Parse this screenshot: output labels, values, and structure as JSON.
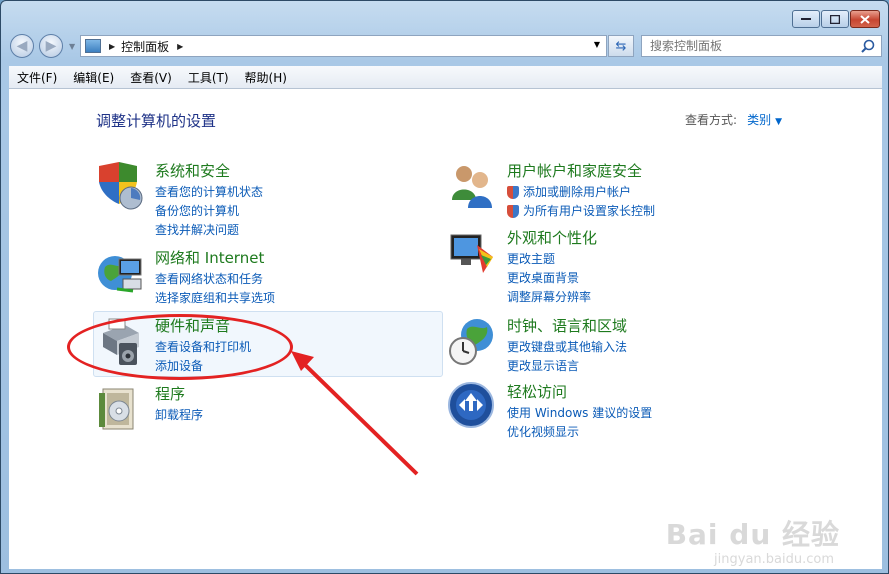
{
  "address": {
    "crumb": "控制面板"
  },
  "search": {
    "placeholder": "搜索控制面板"
  },
  "menu": [
    "文件(F)",
    "编辑(E)",
    "查看(V)",
    "工具(T)",
    "帮助(H)"
  ],
  "page": {
    "title": "调整计算机的设置",
    "view_label": "查看方式:",
    "view_value": "类别"
  },
  "categories": {
    "system": {
      "title": "系统和安全",
      "links": [
        "查看您的计算机状态",
        "备份您的计算机",
        "查找并解决问题"
      ]
    },
    "network": {
      "title": "网络和 Internet",
      "links": [
        "查看网络状态和任务",
        "选择家庭组和共享选项"
      ]
    },
    "hardware": {
      "title": "硬件和声音",
      "links": [
        "查看设备和打印机",
        "添加设备"
      ]
    },
    "programs": {
      "title": "程序",
      "links": [
        "卸载程序"
      ]
    },
    "users": {
      "title": "用户帐户和家庭安全",
      "links": [
        "添加或删除用户帐户",
        "为所有用户设置家长控制"
      ]
    },
    "appearance": {
      "title": "外观和个性化",
      "links": [
        "更改主题",
        "更改桌面背景",
        "调整屏幕分辨率"
      ]
    },
    "clock": {
      "title": "时钟、语言和区域",
      "links": [
        "更改键盘或其他输入法",
        "更改显示语言"
      ]
    },
    "ease": {
      "title": "轻松访问",
      "links": [
        "使用 Windows 建议的设置",
        "优化视频显示"
      ]
    }
  },
  "watermark": {
    "brand": "Bai du 经验",
    "url": "jingyan.baidu.com"
  },
  "colors": {
    "category_title": "#1e7a1e",
    "link": "#0b5bb7",
    "page_title": "#1e3287",
    "annotation": "#e32222"
  }
}
